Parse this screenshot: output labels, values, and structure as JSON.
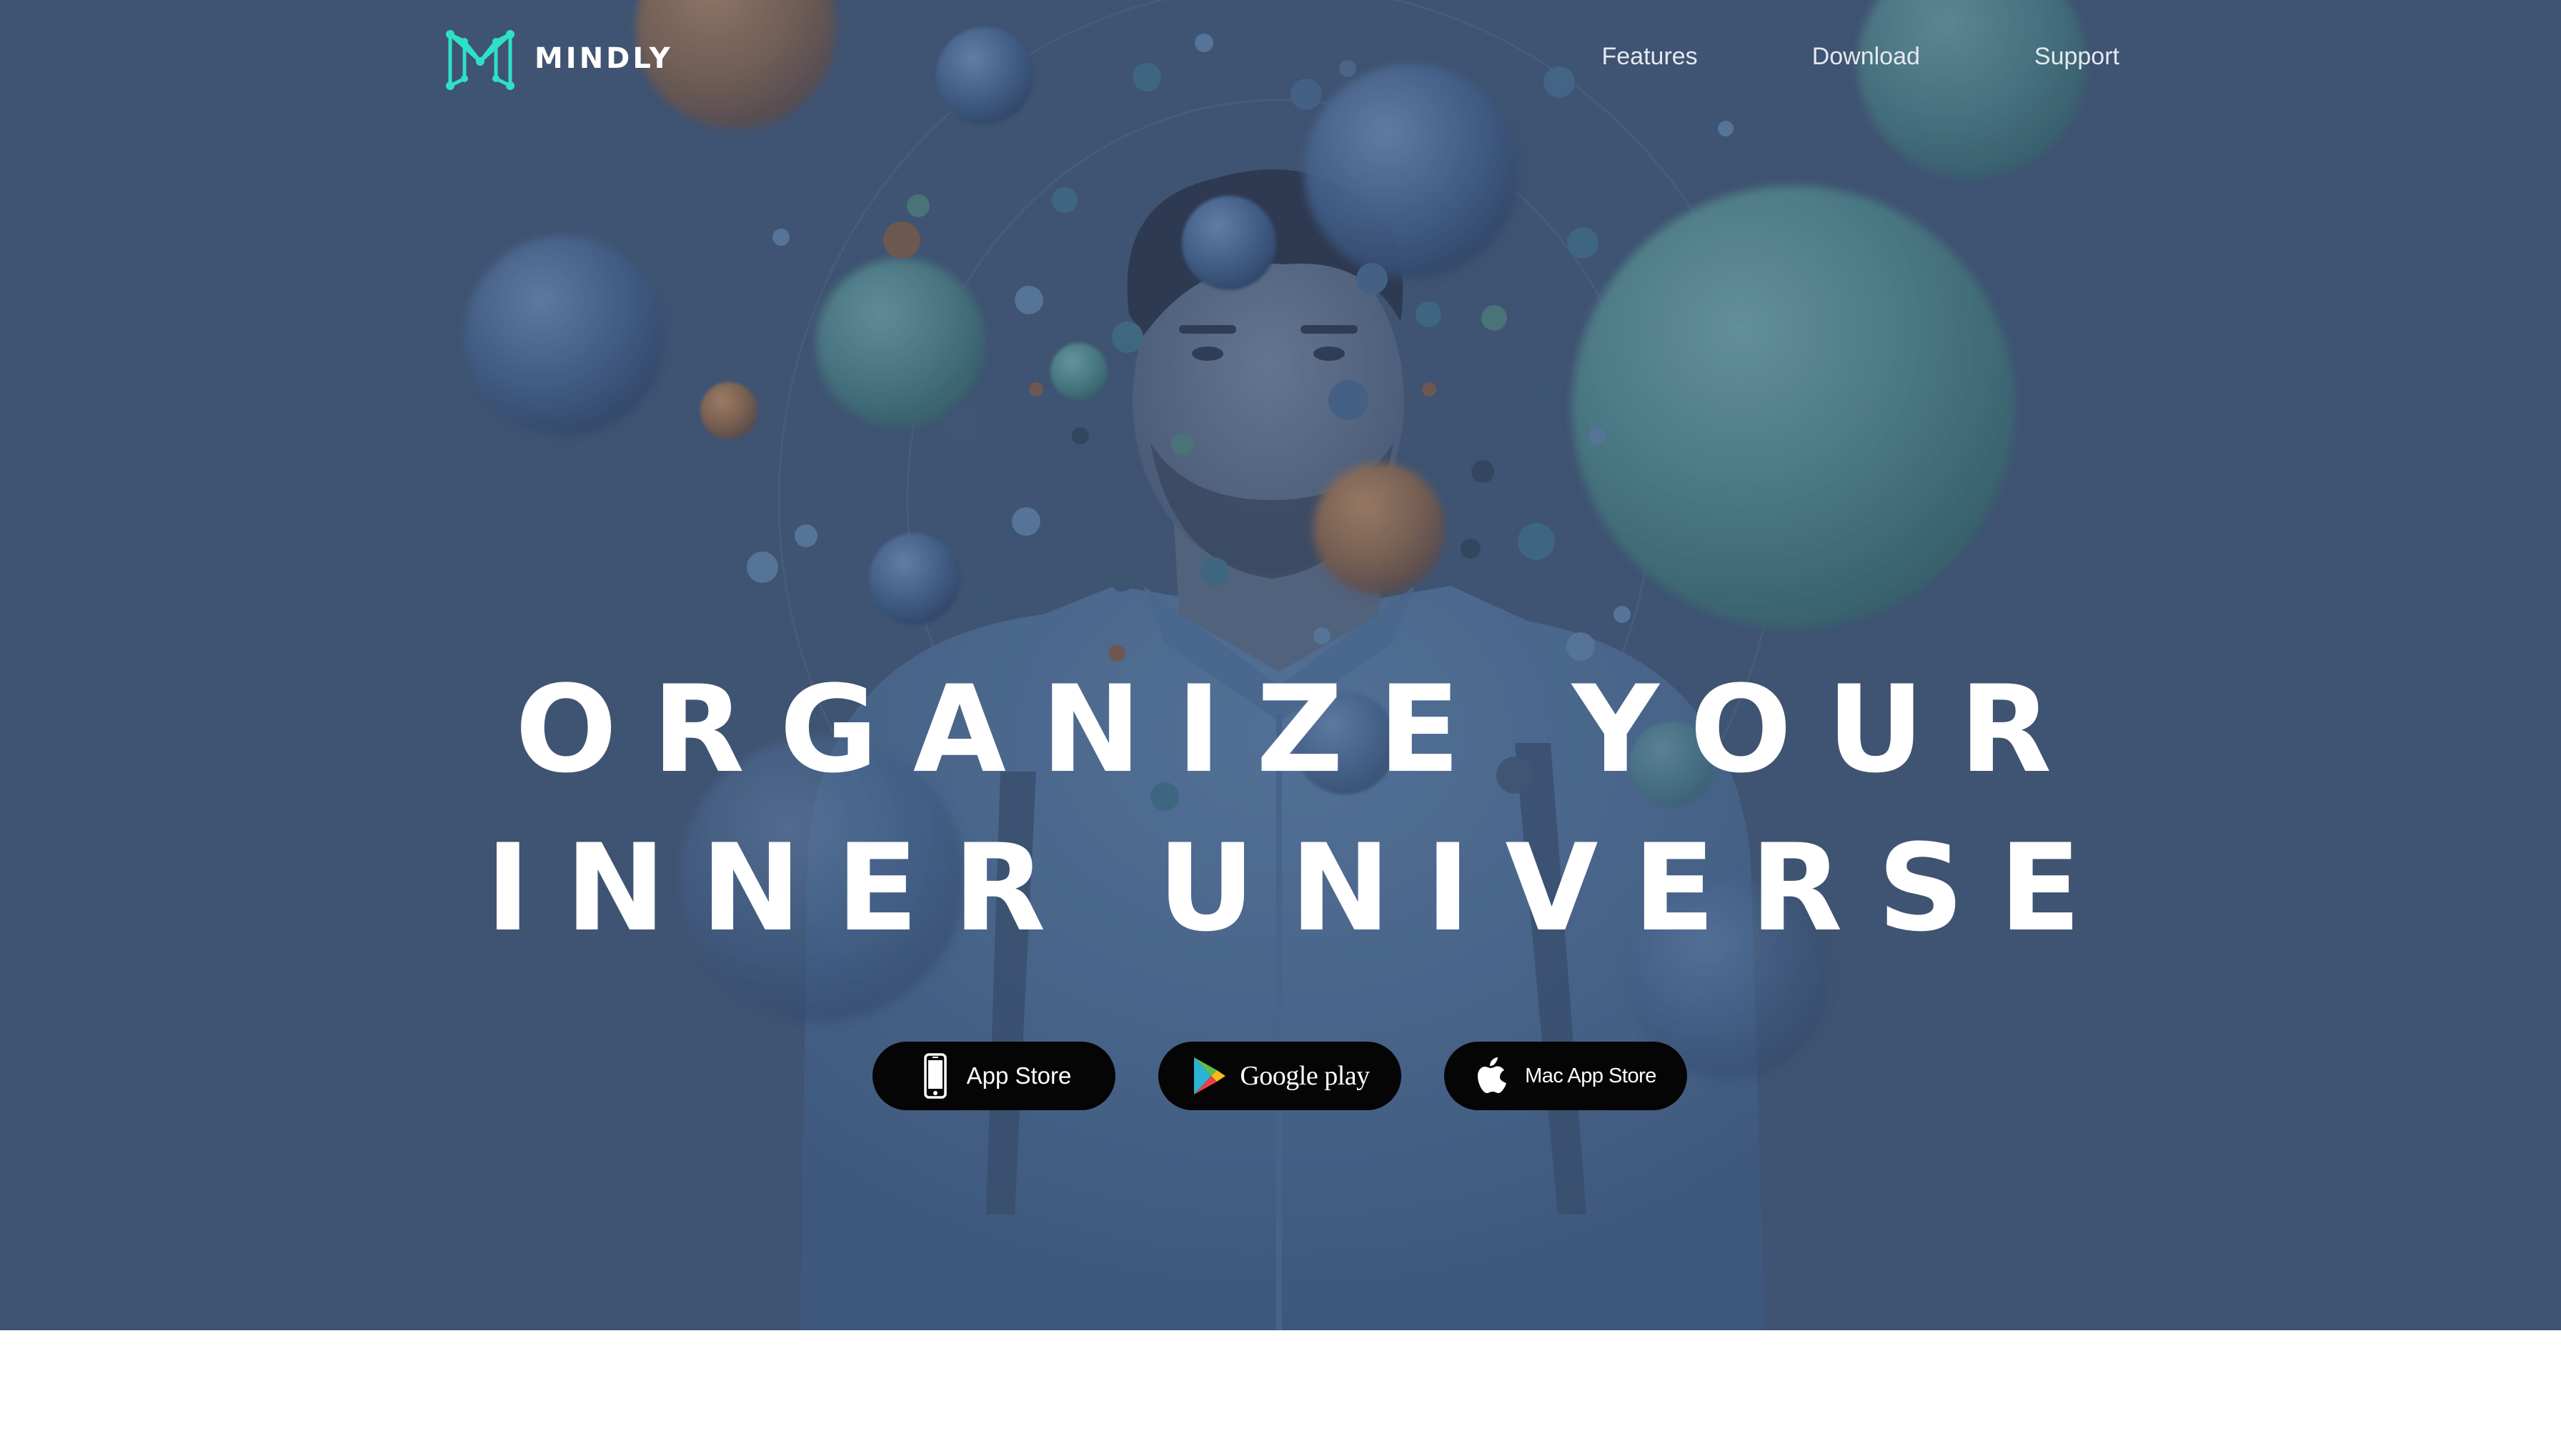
{
  "brand": {
    "name": "MINDLY",
    "logo_icon": "mindly-m-network-icon",
    "accent_color": "#2ee0c6"
  },
  "nav": {
    "items": [
      {
        "label": "Features"
      },
      {
        "label": "Download"
      },
      {
        "label": "Support"
      }
    ]
  },
  "hero": {
    "background_color": "#3f5472",
    "background_image": "man-among-floating-spheres",
    "headline_line1": "ORGANIZE YOUR",
    "headline_line2": "INNER UNIVERSE"
  },
  "downloads": [
    {
      "label": "App Store",
      "icon": "iphone-icon"
    },
    {
      "label": "Google play",
      "icon": "google-play-icon"
    },
    {
      "label": "Mac App Store",
      "icon": "apple-icon"
    }
  ]
}
